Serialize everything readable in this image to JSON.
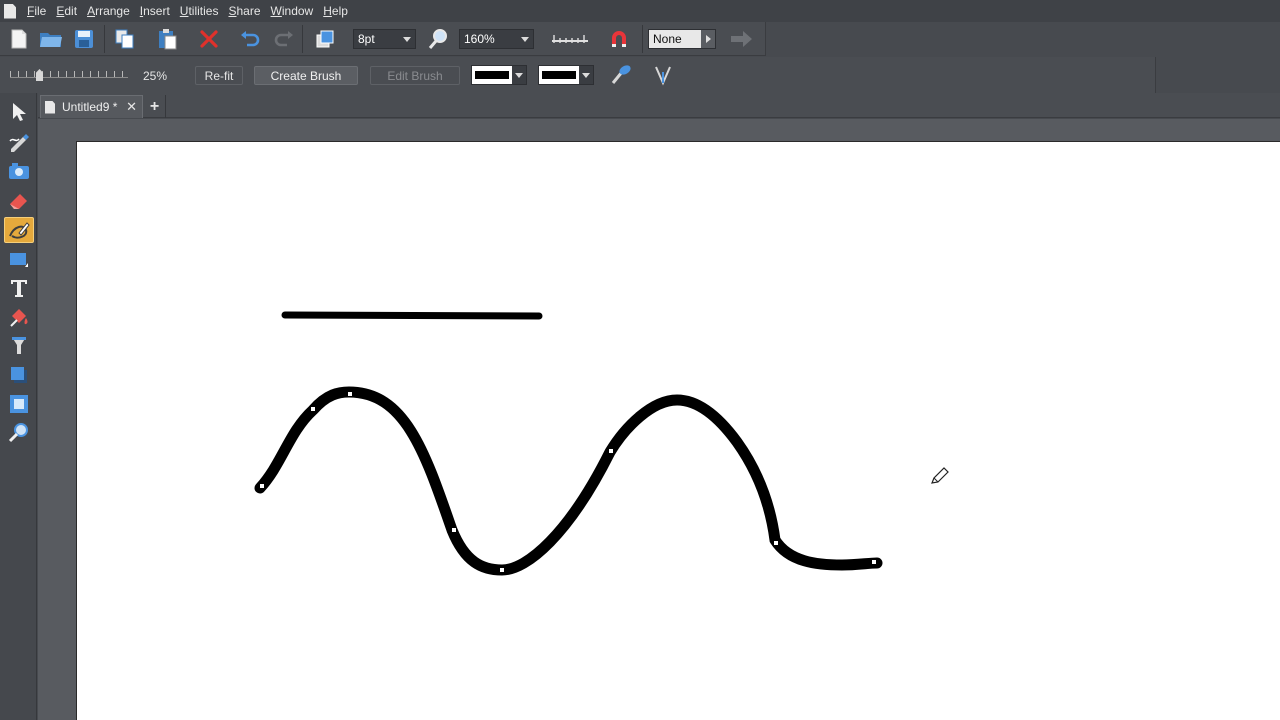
{
  "menu": {
    "items": [
      "File",
      "Edit",
      "Arrange",
      "Insert",
      "Utilities",
      "Share",
      "Window",
      "Help"
    ]
  },
  "toolbar": {
    "line_width": "8pt",
    "zoom": "160%",
    "quality": "None",
    "icons": [
      "new-document-icon",
      "open-folder-icon",
      "save-icon",
      "copy-icon",
      "paste-icon",
      "delete-icon",
      "undo-icon",
      "redo-icon",
      "transform-icon",
      "zoom-icon",
      "ruler-icon",
      "magnet-snap-icon",
      "export-arrow-icon"
    ]
  },
  "brush_bar": {
    "smoothing_value": "25%",
    "smoothing_level": 0.25,
    "refit_label": "Re-fit",
    "create_brush_label": "Create Brush",
    "edit_brush_label": "Edit Brush"
  },
  "tools": [
    "selector-tool-icon",
    "freehand-pen-icon",
    "photo-tool-icon",
    "eraser-tool-icon",
    "brush-tool-icon",
    "rectangle-tool-icon",
    "text-tool-icon",
    "fill-tool-icon",
    "transparency-tool-icon",
    "shadow-tool-icon",
    "frame-tool-icon",
    "zoom-tool-icon"
  ],
  "active_tool": "brush-tool-icon",
  "tabs": [
    {
      "label": "Untitled9 *"
    }
  ],
  "colors": {
    "accent": "#e5a93c",
    "stroke": "#000000",
    "page": "#ffffff"
  }
}
